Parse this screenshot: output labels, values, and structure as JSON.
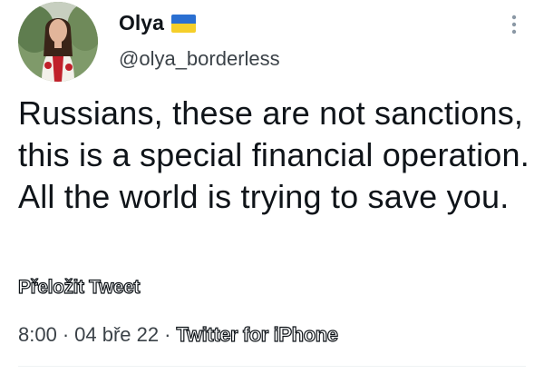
{
  "user": {
    "display_name": "Olya",
    "handle": "@olya_borderless",
    "flag_icon": "ukraine-flag-icon",
    "flag_colors": {
      "top": "#2a6fd1",
      "bottom": "#f5cf2a"
    }
  },
  "tweet": {
    "text": "Russians, these are not sanctions, this is a special financial operation. All the world is trying to save you.",
    "translate_label": "Přeložit Tweet",
    "time": "8:00",
    "date": "04 bře 22",
    "separator": "·",
    "source": "Twitter for iPhone"
  },
  "icons": {
    "more": "more-options-icon"
  },
  "colors": {
    "text": "#0f1419",
    "secondary_text": "#3b4248",
    "divider": "#eff3f4"
  }
}
